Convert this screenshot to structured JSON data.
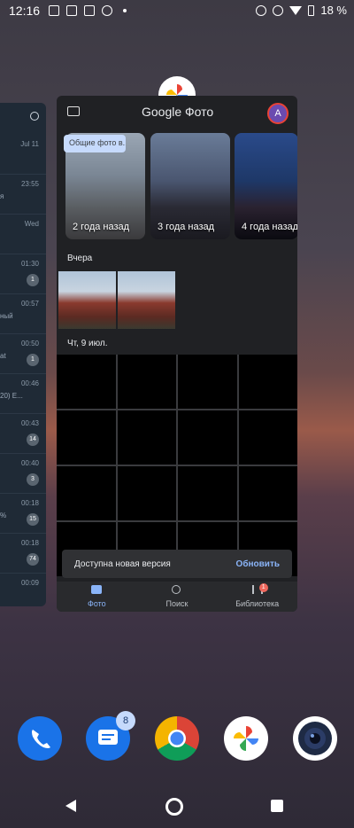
{
  "status_bar": {
    "time": "12:16",
    "battery": "18 %"
  },
  "left_app": {
    "rows": [
      {
        "time": "Jul 11",
        "badge": "",
        "snippet": ""
      },
      {
        "time": "23:55",
        "badge": "",
        "snippet": "я"
      },
      {
        "time": "Wed",
        "badge": "",
        "snippet": ""
      },
      {
        "time": "01:30",
        "badge": "1",
        "snippet": ""
      },
      {
        "time": "00:57",
        "badge": "",
        "snippet": "ный"
      },
      {
        "time": "00:50",
        "badge": "1",
        "snippet": "at"
      },
      {
        "time": "00:46",
        "badge": "",
        "snippet": "20) Е..."
      },
      {
        "time": "00:43",
        "badge": "14",
        "snippet": ""
      },
      {
        "time": "00:40",
        "badge": "3",
        "snippet": ""
      },
      {
        "time": "00:18",
        "badge": "15",
        "snippet": "%"
      },
      {
        "time": "00:18",
        "badge": "74",
        "snippet": ""
      },
      {
        "time": "00:09",
        "badge": "",
        "snippet": ""
      }
    ]
  },
  "photos": {
    "title": "Google Фото",
    "avatar_letter": "A",
    "tooltip": "Общие фото в...",
    "memories": [
      {
        "label": "2 года назад"
      },
      {
        "label": "3 года назад"
      },
      {
        "label": "4 года назад"
      }
    ],
    "section_yesterday": "Вчера",
    "section_date": "Чт, 9 июл.",
    "snackbar": {
      "text": "Доступна новая версия",
      "action": "Обновить"
    },
    "nav": [
      {
        "label": "Фото",
        "icon": "photo-icon",
        "active": true
      },
      {
        "label": "Поиск",
        "icon": "search-icon",
        "active": false
      },
      {
        "label": "Библиотека",
        "icon": "library-icon",
        "active": false,
        "badge": "1"
      }
    ]
  },
  "dock": {
    "messages_badge": "8",
    "apps": [
      "phone-icon",
      "messages-icon",
      "chrome-icon",
      "photos-icon",
      "camera-icon"
    ]
  },
  "colors": {
    "accent": "#8ab4f8",
    "card_bg": "#202124",
    "snackbar_bg": "#303134"
  }
}
